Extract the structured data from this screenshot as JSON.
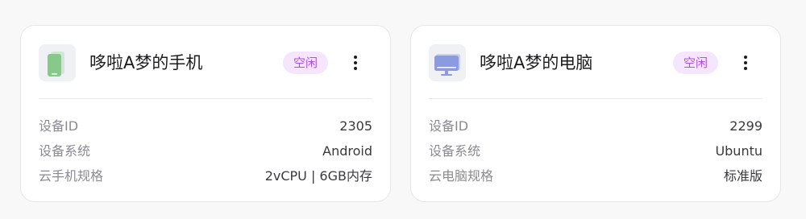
{
  "colors": {
    "page_background": "#f8f8f9",
    "card_background": "#ffffff",
    "badge_background": "#f5e6fd",
    "badge_text": "#b14ee6",
    "phone_icon": "#86c98a",
    "computer_icon": "#8c9be0"
  },
  "devices": [
    {
      "icon": "phone-icon",
      "name": "哆啦A梦的手机",
      "status": "空闲",
      "menu_icon": "more-vertical-icon",
      "details": [
        {
          "label": "设备ID",
          "value": "2305"
        },
        {
          "label": "设备系统",
          "value": "Android"
        },
        {
          "label": "云手机规格",
          "value": "2vCPU | 6GB内存"
        }
      ]
    },
    {
      "icon": "computer-icon",
      "name": "哆啦A梦的电脑",
      "status": "空闲",
      "menu_icon": "more-vertical-icon",
      "details": [
        {
          "label": "设备ID",
          "value": "2299"
        },
        {
          "label": "设备系统",
          "value": "Ubuntu"
        },
        {
          "label": "云电脑规格",
          "value": "标准版"
        }
      ]
    }
  ]
}
